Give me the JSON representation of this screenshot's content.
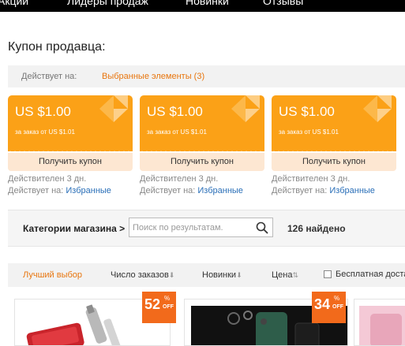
{
  "topnav": {
    "items": [
      "Акции",
      "Лидеры продаж",
      "Новинки",
      "Отзывы"
    ]
  },
  "coupons": {
    "title": "Купон продавца:",
    "applies_label": "Действует на:",
    "applies_link": "Выбранные элементы (3)",
    "items": [
      {
        "amount": "US $1.00",
        "min_order": "за заказ от US $1.01",
        "button": "Получить купон",
        "valid": "Действителен 3 дн.",
        "applies_prefix": "Действует на:",
        "applies_link": "Избранные"
      },
      {
        "amount": "US $1.00",
        "min_order": "за заказ от US $1.01",
        "button": "Получить купон",
        "valid": "Действителен 3 дн.",
        "applies_prefix": "Действует на:",
        "applies_link": "Избранные"
      },
      {
        "amount": "US $1.00",
        "min_order": "за заказ от US $1.01",
        "button": "Получить купон",
        "valid": "Действителен 3 дн.",
        "applies_prefix": "Действует на:",
        "applies_link": "Избранные"
      }
    ]
  },
  "store": {
    "categories_label": "Категории магазина >",
    "search_placeholder": "Поиск по результатам.",
    "found": "126 найдено"
  },
  "sort": {
    "options": [
      "Лучший выбор",
      "Число заказов",
      "Новинки",
      "Цена"
    ],
    "free_shipping": "Бесплатная доставка"
  },
  "products": [
    {
      "discount_num": "52",
      "discount_pct": "%",
      "discount_off": "OFF"
    },
    {
      "discount_num": "34",
      "discount_pct": "%",
      "discount_off": "OFF"
    }
  ],
  "colors": {
    "coupon": "#fba117",
    "accent": "#e8760f",
    "link": "#2a6fb8",
    "badge": "#f26a1b"
  }
}
